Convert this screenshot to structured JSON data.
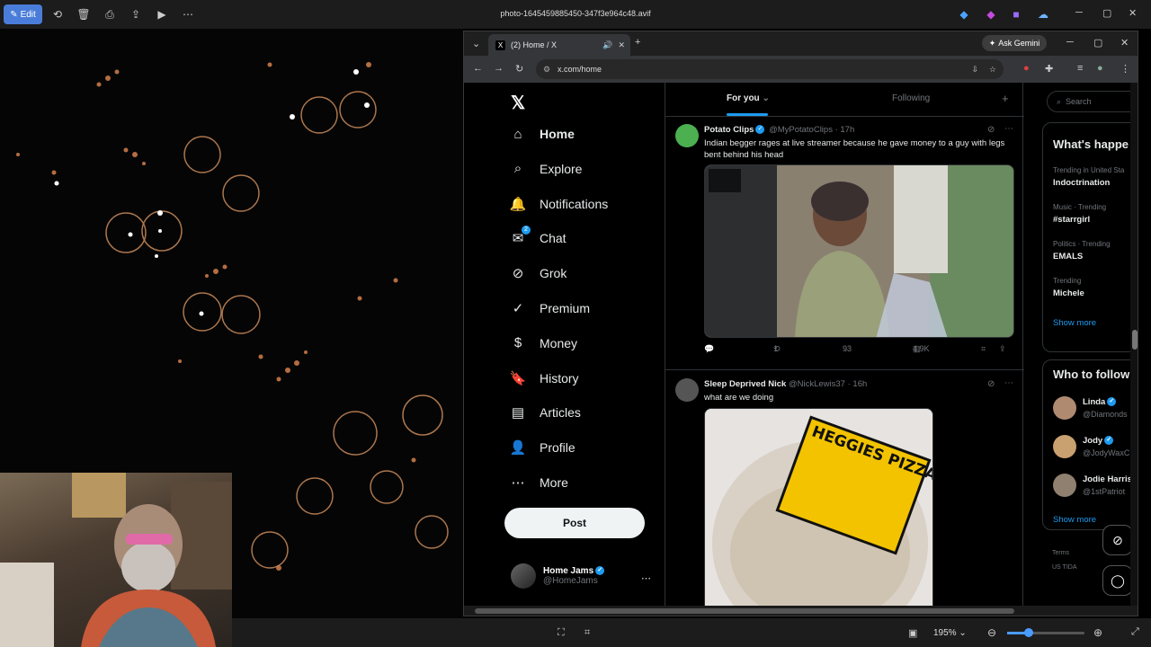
{
  "viewer": {
    "edit_label": "Edit",
    "title": "photo-1645459885450-347f3e964c48.avif",
    "zoom": "195%"
  },
  "browser": {
    "tab_title": "(2) Home / X",
    "ask_gemini": "Ask Gemini",
    "url": "x.com/home"
  },
  "nav": {
    "items": [
      {
        "label": "Home",
        "icon": "home-icon"
      },
      {
        "label": "Explore",
        "icon": "search-icon"
      },
      {
        "label": "Notifications",
        "icon": "bell-icon"
      },
      {
        "label": "Chat",
        "icon": "chat-icon",
        "badge": "2"
      },
      {
        "label": "Grok",
        "icon": "grok-icon"
      },
      {
        "label": "Premium",
        "icon": "premium-icon"
      },
      {
        "label": "Money",
        "icon": "money-icon"
      },
      {
        "label": "History",
        "icon": "bookmark-icon"
      },
      {
        "label": "Articles",
        "icon": "articles-icon"
      },
      {
        "label": "Profile",
        "icon": "profile-icon"
      },
      {
        "label": "More",
        "icon": "more-icon"
      }
    ],
    "post_label": "Post",
    "me": {
      "name": "Home Jams",
      "handle": "@HomeJams"
    }
  },
  "feed": {
    "tabs": [
      "For you",
      "Following"
    ],
    "tweets": [
      {
        "name": "Potato Clips",
        "handle": "@MyPotatoClips",
        "time": "· 17h",
        "text": "Indian begger rages at live streamer because he gave money to a guy with legs bent behind his head",
        "replies": "",
        "retweets": "1",
        "likes": "93",
        "views": "4.9K"
      },
      {
        "name": "Sleep Deprived Nick",
        "handle": "@NickLewis37",
        "time": "· 16h",
        "text": "what are we doing",
        "image_text": "HEGGIES PIZZA"
      }
    ]
  },
  "right": {
    "search_placeholder": "Search",
    "trends_title": "What's happe",
    "trends": [
      {
        "label": "Trending in United Sta",
        "name": "Indoctrination"
      },
      {
        "label": "Music · Trending",
        "name": "#starrgirl"
      },
      {
        "label": "Politics · Trending",
        "name": "EMALS"
      },
      {
        "label": "Trending",
        "name": "Michele"
      }
    ],
    "show_more": "Show more",
    "follow_title": "Who to follow",
    "follow": [
      {
        "name": "Linda",
        "handle": "@Diamonds"
      },
      {
        "name": "Jody",
        "handle": "@JodyWaxC"
      },
      {
        "name": "Jodie Harris",
        "handle": "@1stPatriot"
      }
    ],
    "show_more_2": "Show more",
    "footer": [
      "Terms",
      "US TIDA"
    ]
  },
  "colors": {
    "accent": "#1d9bf0",
    "bg": "#000000",
    "edit": "#4a7dd9"
  }
}
